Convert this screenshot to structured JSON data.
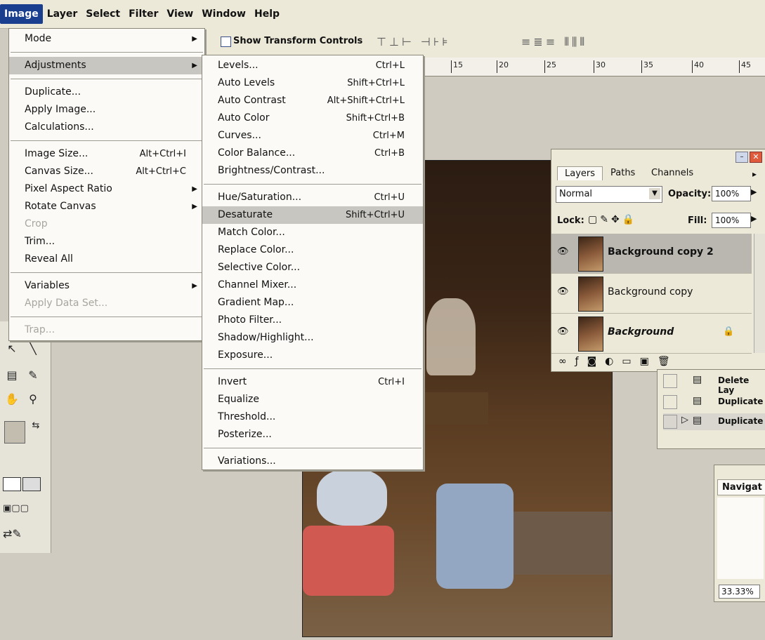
{
  "menubar": {
    "items": [
      "Image",
      "Layer",
      "Select",
      "Filter",
      "View",
      "Window",
      "Help"
    ],
    "active": "Image"
  },
  "options": {
    "show_transform_label": "Show Transform Controls"
  },
  "ruler": {
    "ticks": [
      "15",
      "20",
      "25",
      "30",
      "35",
      "40",
      "45"
    ]
  },
  "image_menu": {
    "mode": "Mode",
    "adjustments": "Adjustments",
    "duplicate": "Duplicate...",
    "apply_image": "Apply Image...",
    "calculations": "Calculations...",
    "image_size": "Image Size...",
    "image_size_sc": "Alt+Ctrl+I",
    "canvas_size": "Canvas Size...",
    "canvas_size_sc": "Alt+Ctrl+C",
    "pixel_aspect": "Pixel Aspect Ratio",
    "rotate_canvas": "Rotate Canvas",
    "crop": "Crop",
    "trim": "Trim...",
    "reveal_all": "Reveal All",
    "variables": "Variables",
    "apply_data_set": "Apply Data Set...",
    "trap": "Trap..."
  },
  "adjust_menu": {
    "levels": "Levels...",
    "levels_sc": "Ctrl+L",
    "auto_levels": "Auto Levels",
    "auto_levels_sc": "Shift+Ctrl+L",
    "auto_contrast": "Auto Contrast",
    "auto_contrast_sc": "Alt+Shift+Ctrl+L",
    "auto_color": "Auto Color",
    "auto_color_sc": "Shift+Ctrl+B",
    "curves": "Curves...",
    "curves_sc": "Ctrl+M",
    "color_balance": "Color Balance...",
    "color_balance_sc": "Ctrl+B",
    "brightness": "Brightness/Contrast...",
    "hue_sat": "Hue/Saturation...",
    "hue_sat_sc": "Ctrl+U",
    "desaturate": "Desaturate",
    "desaturate_sc": "Shift+Ctrl+U",
    "match_color": "Match Color...",
    "replace_color": "Replace Color...",
    "selective_color": "Selective Color...",
    "channel_mixer": "Channel Mixer...",
    "gradient_map": "Gradient Map...",
    "photo_filter": "Photo Filter...",
    "shadow_highlight": "Shadow/Highlight...",
    "exposure": "Exposure...",
    "invert": "Invert",
    "invert_sc": "Ctrl+I",
    "equalize": "Equalize",
    "threshold": "Threshold...",
    "posterize": "Posterize...",
    "variations": "Variations..."
  },
  "layers": {
    "tabs": [
      "Layers",
      "Paths",
      "Channels"
    ],
    "blend_mode": "Normal",
    "opacity_label": "Opacity:",
    "opacity": "100%",
    "lock_label": "Lock:",
    "fill_label": "Fill:",
    "fill": "100%",
    "rows": [
      "Background copy 2",
      "Background copy",
      "Background"
    ]
  },
  "history": {
    "rows": [
      "Delete Lay",
      "Duplicate",
      "Duplicate"
    ]
  },
  "navigator": {
    "tab": "Navigat",
    "zoom": "33.33%"
  }
}
